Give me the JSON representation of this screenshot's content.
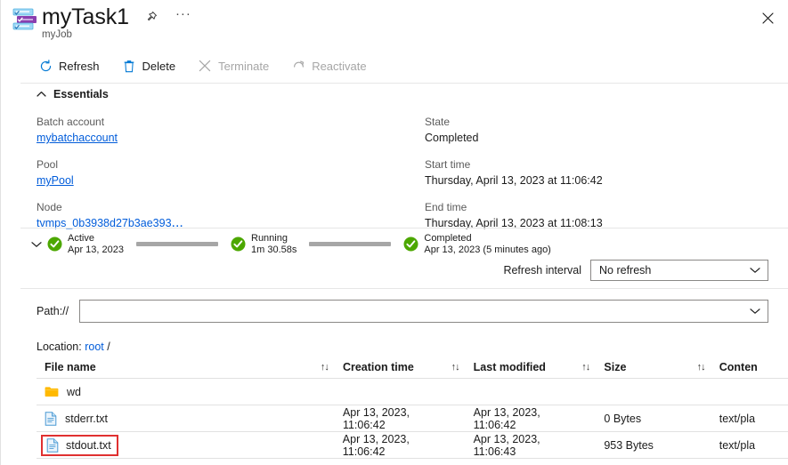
{
  "header": {
    "icon": "batch-task-icon",
    "title": "myTask1",
    "subtitle": "myJob",
    "pin_icon": "pin-icon",
    "more_icon": "ellipsis-icon",
    "close_icon": "close-icon"
  },
  "toolbar": {
    "items": [
      {
        "label": "Refresh",
        "icon": "refresh-icon",
        "disabled": false
      },
      {
        "label": "Delete",
        "icon": "trash-icon",
        "disabled": false
      },
      {
        "label": "Terminate",
        "icon": "x-icon",
        "disabled": true
      },
      {
        "label": "Reactivate",
        "icon": "reactivate-arrow-icon",
        "disabled": true
      }
    ]
  },
  "essentials": {
    "section_label": "Essentials",
    "collapse_icon": "chevron-up-icon",
    "left": [
      {
        "label": "Batch account",
        "value": "mybatchaccount",
        "link": true
      },
      {
        "label": "Pool",
        "value": "myPool",
        "link": true
      },
      {
        "label": "Node",
        "value": "tvmps_0b3938d27b3ae393",
        "link": true,
        "truncated": "..."
      }
    ],
    "right": [
      {
        "label": "State",
        "value": "Completed",
        "link": false
      },
      {
        "label": "Start time",
        "value": "Thursday, April 13, 2023 at 11:06:42",
        "link": false
      },
      {
        "label": "End time",
        "value": "Thursday, April 13, 2023 at 11:08:13",
        "link": false
      }
    ]
  },
  "timeline": {
    "expand_icon": "chevron-down-icon",
    "status_color": "#4ca700",
    "stages": [
      {
        "name": "Active",
        "sub": "Apr 13, 2023",
        "icon": "check-circle-icon"
      },
      {
        "name": "Running",
        "sub": "1m 30.58s",
        "icon": "check-circle-icon"
      },
      {
        "name": "Completed",
        "sub": "Apr 13, 2023 (5 minutes ago)",
        "icon": "check-circle-icon"
      }
    ]
  },
  "refresh": {
    "label": "Refresh interval",
    "value": "No refresh",
    "chevron_icon": "chevron-down-icon"
  },
  "path": {
    "label": "Path://",
    "value": "",
    "placeholder": "",
    "chevron_icon": "chevron-down-icon"
  },
  "location": {
    "prefix": "Location:",
    "link": "root",
    "separator": "/"
  },
  "files": {
    "sort_icon": "sort-updown-icon",
    "columns": [
      {
        "key": "name",
        "label": "File name",
        "sortable": true
      },
      {
        "key": "creation",
        "label": "Creation time",
        "sortable": true
      },
      {
        "key": "modified",
        "label": "Last modified",
        "sortable": true
      },
      {
        "key": "size",
        "label": "Size",
        "sortable": true
      },
      {
        "key": "type",
        "label": "Conten",
        "sortable": false
      }
    ],
    "rows": [
      {
        "name": "wd",
        "icon": "folder-icon",
        "creation": "",
        "modified": "",
        "size": "",
        "type": "",
        "highlighted": false
      },
      {
        "name": "stderr.txt",
        "icon": "file-icon",
        "creation": "Apr 13, 2023, 11:06:42",
        "modified": "Apr 13, 2023, 11:06:42",
        "size": "0 Bytes",
        "type": "text/pla",
        "highlighted": false
      },
      {
        "name": "stdout.txt",
        "icon": "file-icon",
        "creation": "Apr 13, 2023, 11:06:42",
        "modified": "Apr 13, 2023, 11:06:43",
        "size": "953 Bytes",
        "type": "text/pla",
        "highlighted": true
      }
    ]
  },
  "colors": {
    "link": "#015cda",
    "success": "#4ca700",
    "highlight_box": "#e03030",
    "folder": "#ffb900"
  }
}
